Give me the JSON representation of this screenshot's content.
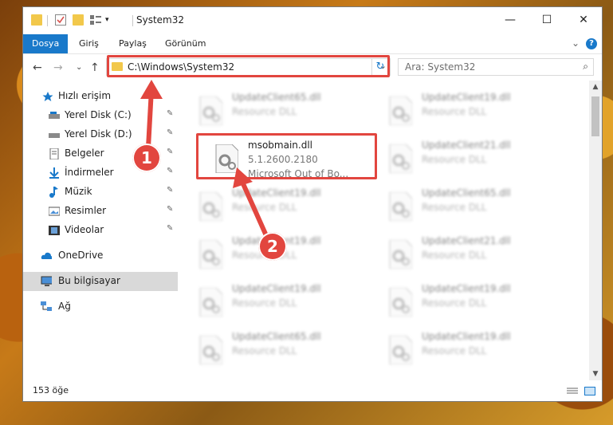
{
  "window": {
    "title": "System32"
  },
  "window_controls": {
    "minimize": "—",
    "maximize": "☐",
    "close": "✕"
  },
  "ribbon": {
    "tabs": [
      "Dosya",
      "Giriş",
      "Paylaş",
      "Görünüm"
    ],
    "expand": "⌄",
    "help": "?"
  },
  "nav": {
    "back": "←",
    "forward": "→",
    "recent": "⌄",
    "up": "↑",
    "address": "C:\\Windows\\System32",
    "address_drop": "⌄",
    "refresh": "↻",
    "search_placeholder": "Ara: System32",
    "search_icon": "⌕"
  },
  "sidebar": {
    "quick_access": "Hızlı erişim",
    "items": [
      {
        "label": "Yerel Disk (C:)",
        "icon": "drive-icon"
      },
      {
        "label": "Yerel Disk (D:)",
        "icon": "drive-icon"
      },
      {
        "label": "Belgeler",
        "icon": "documents-icon"
      },
      {
        "label": "İndirmeler",
        "icon": "downloads-icon"
      },
      {
        "label": "Müzik",
        "icon": "music-icon"
      },
      {
        "label": "Resimler",
        "icon": "pictures-icon"
      },
      {
        "label": "Videolar",
        "icon": "videos-icon"
      }
    ],
    "onedrive": "OneDrive",
    "this_pc": "Bu bilgisayar",
    "network": "Ağ",
    "pin": "📌"
  },
  "files": [
    {
      "name": "UpdateClient65.dll",
      "desc": "Resource DLL",
      "blurred": true
    },
    {
      "name": "UpdateClient19.dll",
      "desc": "Resource DLL",
      "blurred": true
    },
    {
      "name": "msobmain.dll",
      "version": "5.1.2600.2180",
      "desc": "Microsoft Out of Bo...",
      "blurred": false
    },
    {
      "name": "UpdateClient21.dll",
      "desc": "Resource DLL",
      "blurred": true
    },
    {
      "name": "UpdateClient19.dll",
      "desc": "Resource DLL",
      "blurred": true
    },
    {
      "name": "UpdateClient65.dll",
      "desc": "Resource DLL",
      "blurred": true
    },
    {
      "name": "UpdateClient19.dll",
      "desc": "Resource DLL",
      "blurred": true
    },
    {
      "name": "UpdateClient21.dll",
      "desc": "Resource DLL",
      "blurred": true
    },
    {
      "name": "UpdateClient19.dll",
      "desc": "Resource DLL",
      "blurred": true
    },
    {
      "name": "UpdateClient19.dll",
      "desc": "Resource DLL",
      "blurred": true
    },
    {
      "name": "UpdateClient65.dll",
      "desc": "Resource DLL",
      "blurred": true
    },
    {
      "name": "UpdateClient19.dll",
      "desc": "Resource DLL",
      "blurred": true
    }
  ],
  "status": {
    "count": "153 öğe"
  },
  "annotations": {
    "badge1": "1",
    "badge2": "2",
    "color": "#e2463f"
  },
  "colors": {
    "accent": "#1979ca",
    "folder": "#f2c84b"
  }
}
